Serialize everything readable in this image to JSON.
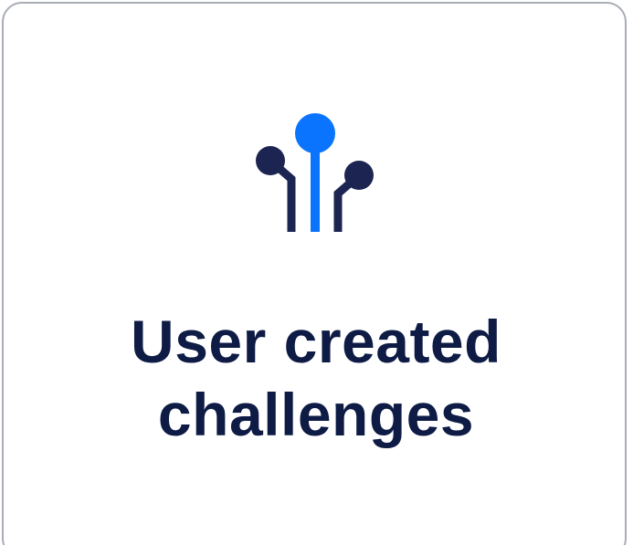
{
  "card": {
    "title_line1": "User created",
    "title_line2": "challenges",
    "icon": "circuit-nodes-icon"
  },
  "colors": {
    "accent": "#0b74ff",
    "title": "#0d1b45",
    "icon_dark": "#1c2452",
    "border": "#a8adb6",
    "background": "#ffffff"
  }
}
